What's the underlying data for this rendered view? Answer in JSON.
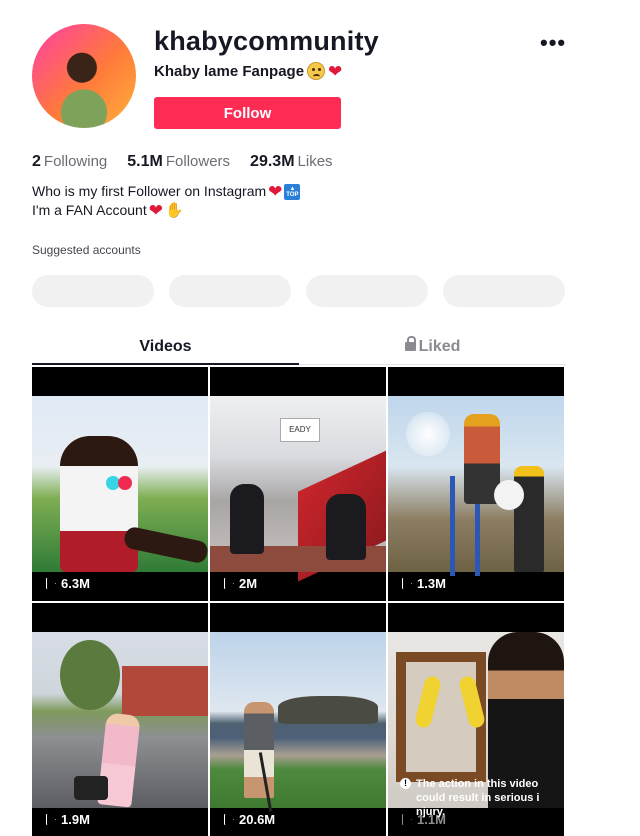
{
  "profile": {
    "username": "khabycommunity",
    "nickname": "Khaby lame Fanpage",
    "follow_label": "Follow",
    "more_label": "•••"
  },
  "stats": [
    {
      "value": "2",
      "label": "Following"
    },
    {
      "value": "5.1M",
      "label": "Followers"
    },
    {
      "value": "29.3M",
      "label": "Likes"
    }
  ],
  "bio": {
    "line1": "Who is my first Follower on Instagram",
    "line2": "I'm a FAN Account",
    "top_badge": "TOP"
  },
  "suggested": {
    "title": "Suggested accounts"
  },
  "tabs": {
    "videos": "Videos",
    "liked": "Liked"
  },
  "videos": [
    {
      "views": "6.3M",
      "sign_text": ""
    },
    {
      "views": "2M",
      "sign_text": "EADY"
    },
    {
      "views": "1.3M",
      "sign_text": ""
    },
    {
      "views": "1.9M",
      "sign_text": ""
    },
    {
      "views": "20.6M",
      "sign_text": ""
    },
    {
      "views": "1.1M",
      "warning": "The action in this video could result in serious i njury."
    }
  ],
  "colors": {
    "accent": "#fe2c55",
    "text": "#161823",
    "muted": "#6b6d74"
  }
}
